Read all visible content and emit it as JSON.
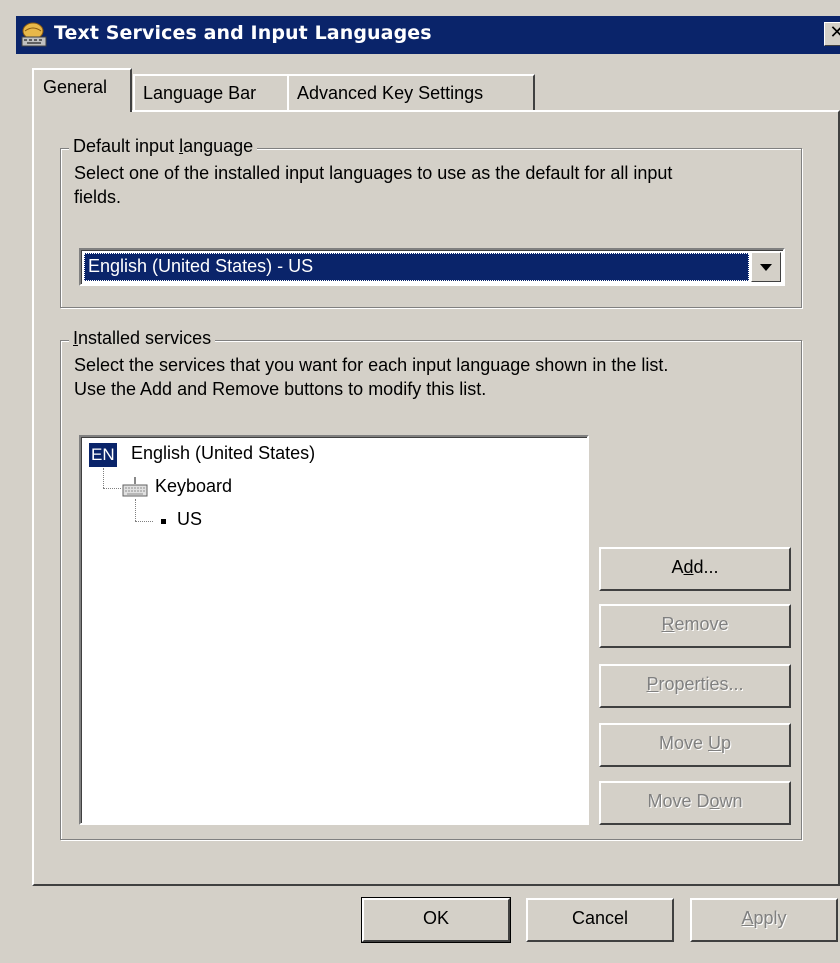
{
  "window": {
    "title": "Text Services and Input Languages",
    "close_label": "✕",
    "icon": "keyboard-globe-icon"
  },
  "tabs": [
    {
      "label": "General",
      "active": true
    },
    {
      "label": "Language Bar",
      "active": false
    },
    {
      "label": "Advanced Key Settings",
      "active": false
    }
  ],
  "default_language": {
    "legend_pre": "Default input ",
    "legend_accel": "l",
    "legend_post": "anguage",
    "description_line1": "Select one of the installed input languages to use as the default for all input",
    "description_line2": "fields.",
    "selected": "English (United States) - US"
  },
  "installed_services": {
    "legend_accel": "I",
    "legend_post": "nstalled services",
    "description_line1": "Select the services that you want for each input language shown in the list.",
    "description_line2": "Use the Add and Remove buttons to modify this list.",
    "tree": {
      "language_badge": "EN",
      "language": "English (United States)",
      "category": "Keyboard",
      "layout": "US"
    }
  },
  "side_buttons": {
    "add": {
      "pre": "A",
      "accel": "d",
      "post": "d..."
    },
    "remove": {
      "pre": "",
      "accel": "R",
      "post": "emove"
    },
    "properties": {
      "pre": "",
      "accel": "P",
      "post": "roperties..."
    },
    "move_up": {
      "pre": "Move ",
      "accel": "U",
      "post": "p"
    },
    "move_down": {
      "pre": "Move D",
      "accel": "o",
      "post": "wn"
    }
  },
  "footer_buttons": {
    "ok": "OK",
    "cancel": "Cancel",
    "apply_accel": "A",
    "apply_post": "pply"
  }
}
